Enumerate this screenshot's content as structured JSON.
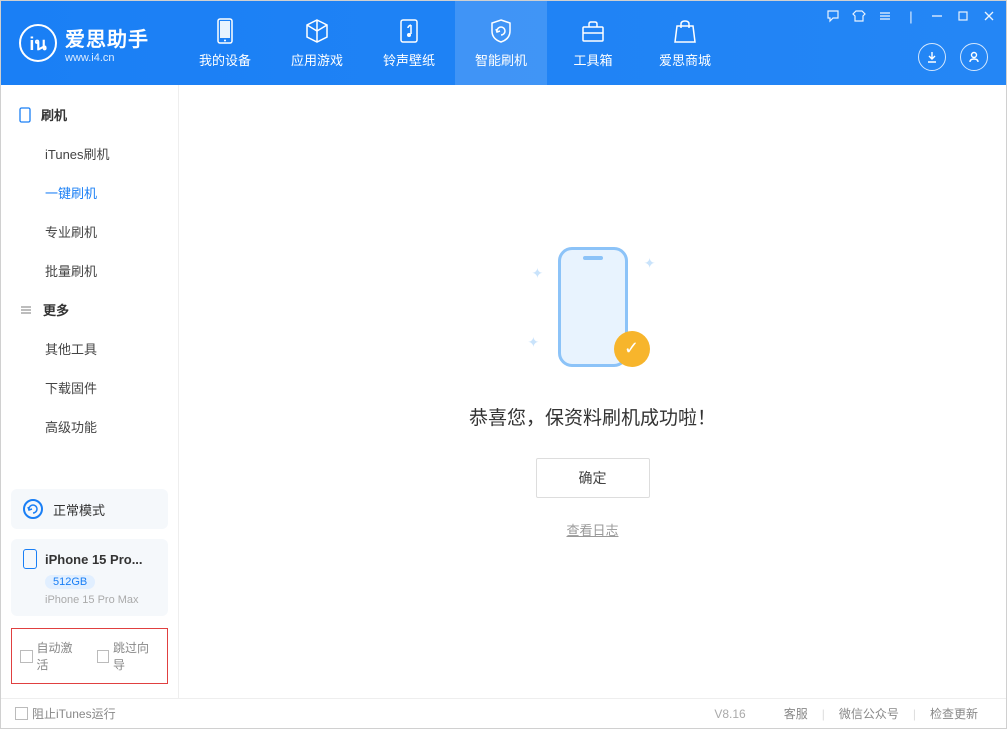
{
  "app": {
    "title": "爱思助手",
    "url": "www.i4.cn"
  },
  "nav": {
    "items": [
      {
        "label": "我的设备"
      },
      {
        "label": "应用游戏"
      },
      {
        "label": "铃声壁纸"
      },
      {
        "label": "智能刷机"
      },
      {
        "label": "工具箱"
      },
      {
        "label": "爱思商城"
      }
    ]
  },
  "sidebar": {
    "group1": {
      "title": "刷机",
      "items": [
        "iTunes刷机",
        "一键刷机",
        "专业刷机",
        "批量刷机"
      ]
    },
    "group2": {
      "title": "更多",
      "items": [
        "其他工具",
        "下载固件",
        "高级功能"
      ]
    },
    "mode_label": "正常模式",
    "device": {
      "name": "iPhone 15 Pro...",
      "storage": "512GB",
      "sub": "iPhone 15 Pro Max"
    },
    "cb_auto_activate": "自动激活",
    "cb_skip_wizard": "跳过向导"
  },
  "main": {
    "success_text": "恭喜您，保资料刷机成功啦！",
    "ok_button": "确定",
    "log_link": "查看日志"
  },
  "footer": {
    "block_itunes": "阻止iTunes运行",
    "version": "V8.16",
    "support": "客服",
    "wechat": "微信公众号",
    "update": "检查更新"
  }
}
